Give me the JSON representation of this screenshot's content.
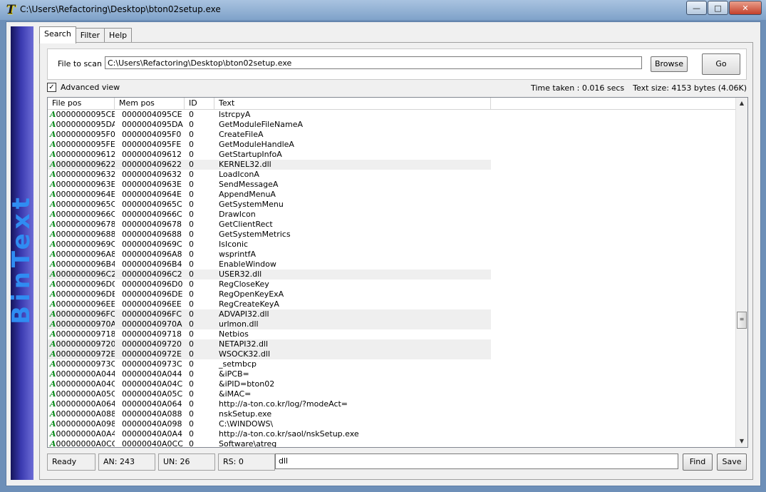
{
  "window": {
    "title": "C:\\Users\\Refactoring\\Desktop\\bton02setup.exe",
    "app_icon_glyph": "T",
    "controls": {
      "minimize": "—",
      "maximize": "□",
      "close": "✕"
    }
  },
  "sidebar": {
    "logo_text": "BinText"
  },
  "tabs": [
    {
      "label": "Search"
    },
    {
      "label": "Filter"
    },
    {
      "label": "Help"
    }
  ],
  "scan": {
    "label": "File to scan",
    "value": "C:\\Users\\Refactoring\\Desktop\\bton02setup.exe",
    "browse_label": "Browse",
    "go_label": "Go"
  },
  "advanced": {
    "checked_mark": "✓",
    "label": "Advanced view"
  },
  "stats": {
    "time_taken": "Time taken : 0.016 secs",
    "text_size": "Text size: 4153 bytes (4.06K)"
  },
  "list": {
    "columns": [
      "File pos",
      "Mem pos",
      "ID",
      "Text"
    ],
    "type_glyph": "A",
    "rows": [
      {
        "file": "0000000095CE",
        "mem": "0000004095CE",
        "id": "0",
        "text": "lstrcpyA",
        "hl": false
      },
      {
        "file": "0000000095DA",
        "mem": "0000004095DA",
        "id": "0",
        "text": "GetModuleFileNameA",
        "hl": false
      },
      {
        "file": "0000000095F0",
        "mem": "0000004095F0",
        "id": "0",
        "text": "CreateFileA",
        "hl": false
      },
      {
        "file": "0000000095FE",
        "mem": "0000004095FE",
        "id": "0",
        "text": "GetModuleHandleA",
        "hl": false
      },
      {
        "file": "000000009612",
        "mem": "000000409612",
        "id": "0",
        "text": "GetStartupInfoA",
        "hl": false
      },
      {
        "file": "000000009622",
        "mem": "000000409622",
        "id": "0",
        "text": "KERNEL32.dll",
        "hl": true
      },
      {
        "file": "000000009632",
        "mem": "000000409632",
        "id": "0",
        "text": "LoadIconA",
        "hl": false
      },
      {
        "file": "00000000963E",
        "mem": "00000040963E",
        "id": "0",
        "text": "SendMessageA",
        "hl": false
      },
      {
        "file": "00000000964E",
        "mem": "00000040964E",
        "id": "0",
        "text": "AppendMenuA",
        "hl": false
      },
      {
        "file": "00000000965C",
        "mem": "00000040965C",
        "id": "0",
        "text": "GetSystemMenu",
        "hl": false
      },
      {
        "file": "00000000966C",
        "mem": "00000040966C",
        "id": "0",
        "text": "DrawIcon",
        "hl": false
      },
      {
        "file": "000000009678",
        "mem": "000000409678",
        "id": "0",
        "text": "GetClientRect",
        "hl": false
      },
      {
        "file": "000000009688",
        "mem": "000000409688",
        "id": "0",
        "text": "GetSystemMetrics",
        "hl": false
      },
      {
        "file": "00000000969C",
        "mem": "00000040969C",
        "id": "0",
        "text": "IsIconic",
        "hl": false
      },
      {
        "file": "0000000096A8",
        "mem": "0000004096A8",
        "id": "0",
        "text": "wsprintfA",
        "hl": false
      },
      {
        "file": "0000000096B4",
        "mem": "0000004096B4",
        "id": "0",
        "text": "EnableWindow",
        "hl": false
      },
      {
        "file": "0000000096C2",
        "mem": "0000004096C2",
        "id": "0",
        "text": "USER32.dll",
        "hl": true
      },
      {
        "file": "0000000096D0",
        "mem": "0000004096D0",
        "id": "0",
        "text": "RegCloseKey",
        "hl": false
      },
      {
        "file": "0000000096DE",
        "mem": "0000004096DE",
        "id": "0",
        "text": "RegOpenKeyExA",
        "hl": false
      },
      {
        "file": "0000000096EE",
        "mem": "0000004096EE",
        "id": "0",
        "text": "RegCreateKeyA",
        "hl": false
      },
      {
        "file": "0000000096FC",
        "mem": "0000004096FC",
        "id": "0",
        "text": "ADVAPI32.dll",
        "hl": true
      },
      {
        "file": "00000000970A",
        "mem": "00000040970A",
        "id": "0",
        "text": "urlmon.dll",
        "hl": true
      },
      {
        "file": "000000009718",
        "mem": "000000409718",
        "id": "0",
        "text": "Netbios",
        "hl": false
      },
      {
        "file": "000000009720",
        "mem": "000000409720",
        "id": "0",
        "text": "NETAPI32.dll",
        "hl": true
      },
      {
        "file": "00000000972E",
        "mem": "00000040972E",
        "id": "0",
        "text": "WSOCK32.dll",
        "hl": true
      },
      {
        "file": "00000000973C",
        "mem": "00000040973C",
        "id": "0",
        "text": "_setmbcp",
        "hl": false
      },
      {
        "file": "00000000A044",
        "mem": "00000040A044",
        "id": "0",
        "text": "&iPCB=",
        "hl": false
      },
      {
        "file": "00000000A04C",
        "mem": "00000040A04C",
        "id": "0",
        "text": "&iPID=bton02",
        "hl": false
      },
      {
        "file": "00000000A05C",
        "mem": "00000040A05C",
        "id": "0",
        "text": "&iMAC=",
        "hl": false
      },
      {
        "file": "00000000A064",
        "mem": "00000040A064",
        "id": "0",
        "text": "http://a-ton.co.kr/log/?modeAct=",
        "hl": false
      },
      {
        "file": "00000000A088",
        "mem": "00000040A088",
        "id": "0",
        "text": "nskSetup.exe",
        "hl": false
      },
      {
        "file": "00000000A098",
        "mem": "00000040A098",
        "id": "0",
        "text": "C:\\WINDOWS\\",
        "hl": false
      },
      {
        "file": "00000000A0A4",
        "mem": "00000040A0A4",
        "id": "0",
        "text": "http://a-ton.co.kr/saol/nskSetup.exe",
        "hl": false
      },
      {
        "file": "00000000A0CC",
        "mem": "00000040A0CC",
        "id": "0",
        "text": "Software\\atreg",
        "hl": false
      }
    ]
  },
  "scrollbar": {
    "up": "▲",
    "down": "▼",
    "grip": "≡"
  },
  "status": {
    "state": "Ready",
    "an": "AN: 243",
    "un": "UN: 26",
    "rs": "RS: 0",
    "find_value": "dll",
    "find_label": "Find",
    "save_label": "Save"
  }
}
